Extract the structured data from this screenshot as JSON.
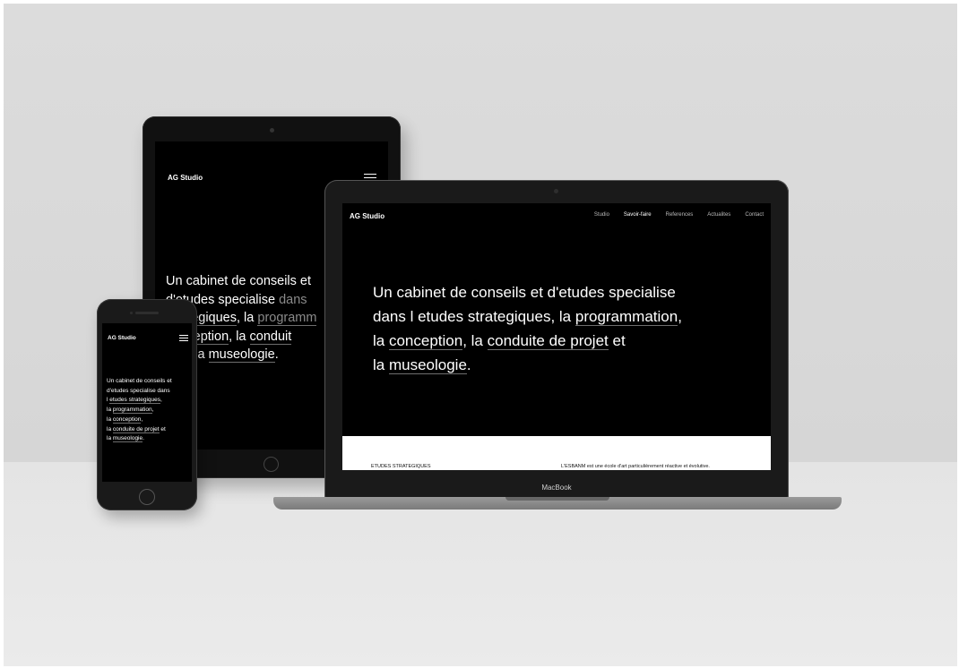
{
  "tablet": {
    "brand": "AG Studio",
    "headline": {
      "line1": "Un cabinet de conseils et",
      "line2_a": "d'etudes specialise ",
      "line2_b": "dans",
      "line3_a": "strategiques",
      "line3_b": ", la ",
      "line3_c": "programm",
      "line4_a": "conception",
      "line4_b": ", la ",
      "line4_c": "conduit",
      "line5_a": "et et la ",
      "line5_b": "museologie",
      "line5_c": "."
    }
  },
  "laptop": {
    "brand": "AG Studio",
    "nav": [
      "Studio",
      "Savoir-faire",
      "References",
      "Actualites",
      "Contact"
    ],
    "headline": {
      "line1": "Un cabinet de conseils et d'etudes specialise",
      "line2_a": "dans l etudes strategiques, la ",
      "line2_b": "programmation",
      "line2_c": ",",
      "line3_a": "la ",
      "line3_b": "conception",
      "line3_c": ", la ",
      "line3_d": "conduite de projet",
      "line3_e": " et",
      "line4_a": "la ",
      "line4_b": "museologie",
      "line4_c": "."
    },
    "panel_left": "ETUDES STRATEGIQUES",
    "panel_right": "L'ESBANM est une école d'art particulièrement réactive et évolutive.",
    "label": "MacBook"
  },
  "phone": {
    "brand": "AG Studio",
    "headline": {
      "line1": "Un cabinet de conseils et",
      "line2": "d'etudes specialise dans",
      "line3_a": "l ",
      "line3_b": "etudes strategiques",
      "line3_c": ",",
      "line4_a": "la ",
      "line4_b": "programmation",
      "line4_c": ",",
      "line5_a": "la ",
      "line5_b": "conception",
      "line5_c": ",",
      "line6_a": "la ",
      "line6_b": "conduite de projet",
      "line6_c": " et",
      "line7_a": "la ",
      "line7_b": "museologie",
      "line7_c": "."
    }
  }
}
